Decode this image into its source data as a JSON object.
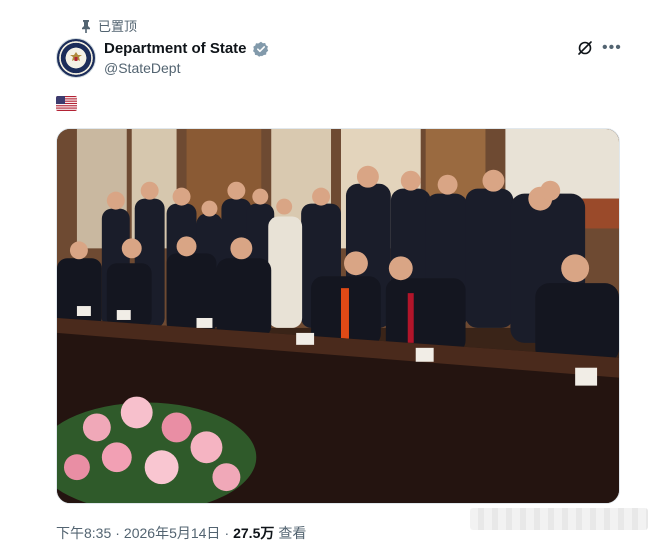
{
  "header": {
    "pinned_label": "已置顶"
  },
  "author": {
    "display_name": "Department of State",
    "handle": "@StateDept",
    "verified": true,
    "avatar_icon": "state-department-seal-icon"
  },
  "tweet": {
    "flag_icon": "us-flag-emoji",
    "media_icon": "photo-delegation-meeting",
    "time": "下午8:35",
    "separator": "·",
    "date": "2026年5月14日",
    "views_count": "27.5万",
    "views_label": "查看"
  },
  "colors": {
    "text_primary": "#0f1419",
    "text_secondary": "#536471",
    "verified_badge": "#829aab"
  }
}
